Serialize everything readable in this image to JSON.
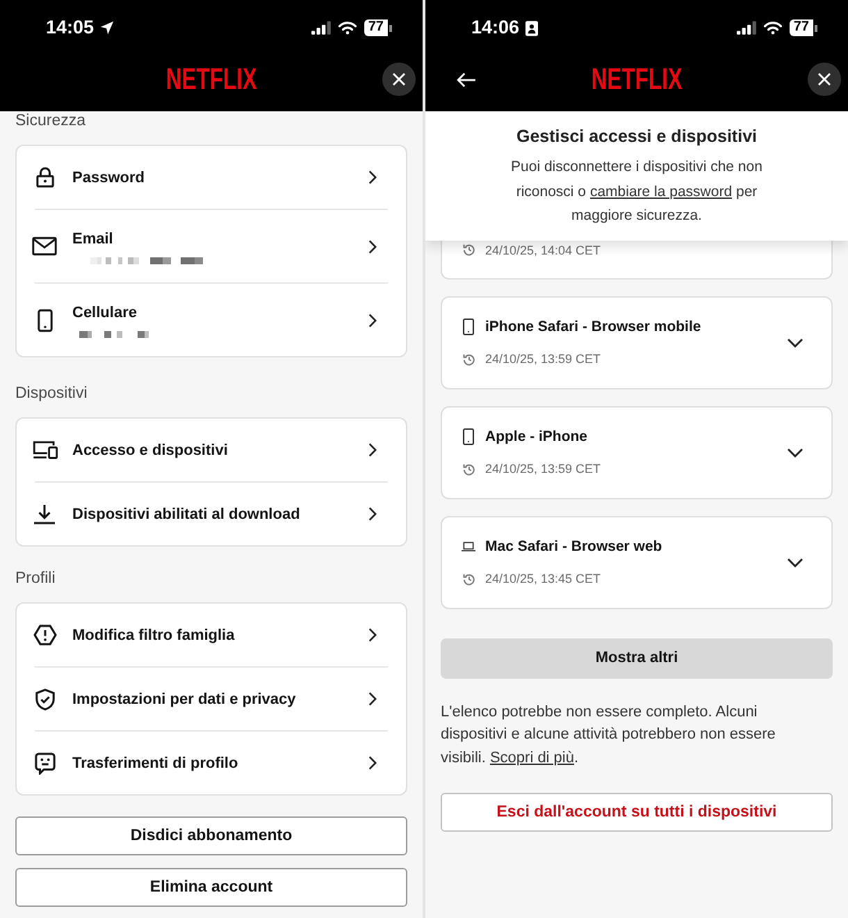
{
  "settings_screen": {
    "status_bar": {
      "time": "14:05",
      "battery": "77"
    },
    "header": {
      "logo": "NETFLIX",
      "back_button": false
    },
    "sections": [
      {
        "title": "Sicurezza",
        "items": [
          {
            "label": "Password",
            "blurred_value": false
          },
          {
            "label": "Email",
            "blurred_value": true
          },
          {
            "label": "Cellulare",
            "blurred_value": true
          }
        ]
      },
      {
        "title": "Dispositivi",
        "items": [
          {
            "label": "Accesso e dispositivi"
          },
          {
            "label": "Dispositivi abilitati al download"
          }
        ]
      },
      {
        "title": "Profili",
        "items": [
          {
            "label": "Modifica filtro famiglia"
          },
          {
            "label": "Impostazioni per dati e privacy"
          },
          {
            "label": "Trasferimenti di profilo"
          }
        ]
      }
    ],
    "buttons": [
      "Disdici abbonamento",
      "Elimina account"
    ]
  },
  "devices_screen": {
    "status_bar": {
      "time": "14:06",
      "battery": "77"
    },
    "header": {
      "logo": "NETFLIX",
      "back_button": true
    },
    "sheet": {
      "title": "Gestisci accessi e dispositivi",
      "text_before": "Puoi disconnettere i dispositivi che non riconosci o ",
      "link": "cambiare la password",
      "text_after": " per maggiore sicurezza."
    },
    "covered_device": {
      "time": "24/10/25, 14:04 CET"
    },
    "devices": [
      {
        "name": "iPhone Safari - Browser mobile",
        "time": "24/10/25, 13:59 CET",
        "expanded": false
      },
      {
        "name": "Apple - iPhone",
        "time": "24/10/25, 13:59 CET",
        "expanded": false
      },
      {
        "name": "Mac Safari - Browser web",
        "time": "24/10/25, 13:45 CET",
        "expanded": false
      }
    ],
    "show_more_button": "Mostra altri",
    "note": {
      "text": "L'elenco potrebbe non essere completo. Alcuni dispositivi e alcune attività potrebbero non essere visibili. ",
      "link": "Scopri di più",
      "text_after": "."
    },
    "sign_out_all_button": "Esci dall'account su tutti i dispositivi"
  }
}
